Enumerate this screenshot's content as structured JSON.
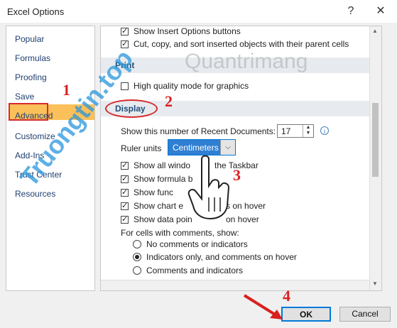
{
  "window": {
    "title": "Excel Options",
    "help": "?",
    "close": "✕"
  },
  "sidebar": {
    "items": [
      {
        "label": "Popular"
      },
      {
        "label": "Formulas"
      },
      {
        "label": "Proofing"
      },
      {
        "label": "Save"
      },
      {
        "label": "Advanced"
      },
      {
        "label": "Customize"
      },
      {
        "label": "Add-Ins"
      },
      {
        "label": "Trust Center"
      },
      {
        "label": "Resources"
      }
    ],
    "selected": "Advanced"
  },
  "content": {
    "cut_options": {
      "label": "Show Insert Options buttons",
      "checked": true
    },
    "cut_copy_sort": {
      "label": "Cut, copy, and sort inserted objects with their parent cells",
      "checked": true
    },
    "print_section": "Print",
    "high_quality": {
      "label": "High quality mode for graphics",
      "checked": false
    },
    "display_section": "Display",
    "recent_docs": {
      "label": "Show this number of Recent Documents:",
      "value": "17"
    },
    "ruler_units": {
      "label": "Ruler units",
      "value": "Centimeters"
    },
    "show_all_windows": {
      "label": "Show all windows in the Taskbar",
      "visible": "Show all windo",
      "rest": "the Taskbar",
      "checked": true
    },
    "show_formula_bar": {
      "label": "Show formula bar",
      "visible": "Show formula b",
      "checked": true
    },
    "show_function": {
      "label": "Show function ScreenTips",
      "visible": "Show func",
      "checked": true
    },
    "show_chart": {
      "label": "Show chart element names on hover",
      "visible": "Show chart e",
      "rest": "s on hover",
      "checked": true
    },
    "show_data_point": {
      "label": "Show data point values on hover",
      "visible": "Show data poin",
      "rest": "on hover",
      "checked": true
    },
    "comments_label": "For cells with comments, show:",
    "comments_options": [
      {
        "label": "No comments or indicators",
        "selected": false
      },
      {
        "label": "Indicators only, and comments on hover",
        "selected": true
      },
      {
        "label": "Comments and indicators",
        "selected": false
      }
    ]
  },
  "buttons": {
    "ok": "OK",
    "cancel": "Cancel"
  },
  "annotations": {
    "n1": "1",
    "n2": "2",
    "n3": "3",
    "n4": "4"
  },
  "watermarks": {
    "left": "Truongtin.top",
    "center": "Quantrimang"
  },
  "colors": {
    "accent": "#0078d7",
    "highlight": "#fbc05a",
    "annotation": "#d82020"
  }
}
